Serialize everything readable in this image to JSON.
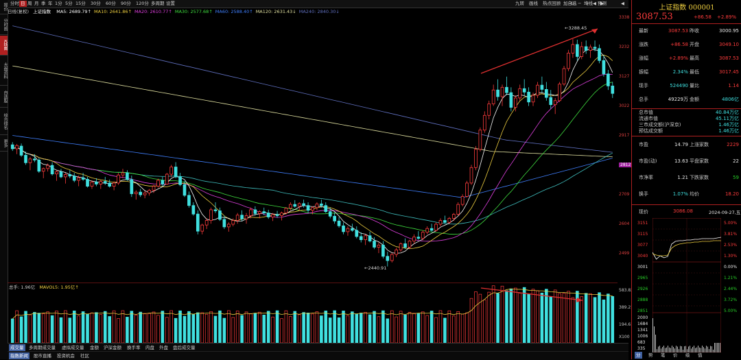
{
  "left_tabs": [
    "报价",
    "分时图",
    "K线图",
    "大盘资料",
    "自选股",
    "综合排名",
    "更多"
  ],
  "toolbar": {
    "left_items": [
      "分时",
      "日",
      "周",
      "月",
      "季",
      "年",
      "1分",
      "5分",
      "15分",
      "30分",
      "60分",
      "90分",
      "120分",
      "多周期",
      "设置"
    ],
    "right_items": [
      "九转",
      "画线",
      "热点回顾",
      "加自选",
      "均线",
      "预测"
    ],
    "icons": [
      "refresh-icon",
      "minus-icon",
      "plus-icon",
      "arrow-left-icon",
      "arrow-right-icon",
      "wrench-icon",
      "settings-icon",
      "play-icon"
    ]
  },
  "info_bar": {
    "series": "日线(复权)",
    "name": "上证指数",
    "ma": [
      {
        "label": "MA5: 2689.79↑",
        "color": "#ffffff"
      },
      {
        "label": "MA10: 2641.86↑",
        "color": "#f0d040"
      },
      {
        "label": "MA20: 2610.77↑",
        "color": "#e040e0"
      },
      {
        "label": "MA30: 2577.68↑",
        "color": "#40e040"
      },
      {
        "label": "MA60: 2588.40↑",
        "color": "#4080ff"
      },
      {
        "label": "MA120: 2631.43↓",
        "color": "#e0e0a0"
      },
      {
        "label": "MA240: 2840.30↓",
        "color": "#6070c0"
      }
    ]
  },
  "price_axis": {
    "ticks": [
      "3338",
      "3232",
      "3127",
      "3022",
      "2917",
      "2812",
      "2709",
      "2604",
      "2499"
    ],
    "highlight": "2812"
  },
  "annotations": {
    "high": "3288.45",
    "low": "2440.91"
  },
  "volume": {
    "label": "总手: 1.96亿",
    "mavol": "MAVOL5: 1.95亿↑",
    "ticks": [
      "583.82万",
      "389.21万",
      "194.61万",
      "X100"
    ]
  },
  "bottom_tabs_1": [
    "成交量",
    "多周期成交量",
    "虚拟成交量",
    "金额",
    "沪深金额",
    "换手率",
    "内盘",
    "外盘",
    "盘后成交量"
  ],
  "bottom_tabs_2": [
    "指数新闻",
    "股市直播",
    "投资机会",
    "社区"
  ],
  "quote": {
    "title": "上证指数 000001",
    "price": "3087.53",
    "change": "+86.58",
    "change_pct": "+2.89%"
  },
  "stats": [
    {
      "l1": "最新",
      "v1": "3087.53",
      "c1": "red",
      "l2": "昨收",
      "v2": "3000.95",
      "c2": "white"
    },
    {
      "l1": "涨跌",
      "v1": "+86.58",
      "c1": "red",
      "l2": "开盘",
      "v2": "3049.10",
      "c2": "red"
    },
    {
      "l1": "涨幅",
      "v1": "+2.89%",
      "c1": "red",
      "l2": "最高",
      "v2": "3087.53",
      "c2": "red"
    },
    {
      "l1": "振幅",
      "v1": "2.34%",
      "c1": "cyan",
      "l2": "最低",
      "v2": "3017.45",
      "c2": "red"
    },
    {
      "l1": "现手",
      "v1": "524490",
      "c1": "cyan",
      "l2": "量比",
      "v2": "1.14",
      "c2": "red"
    },
    {
      "l1": "总手",
      "v1": "49229万",
      "c1": "white",
      "l2": "金额",
      "v2": "4806亿",
      "c2": "cyan"
    }
  ],
  "market_values": [
    {
      "label": "总市值",
      "value": "40.84万亿"
    },
    {
      "label": "流通市值",
      "value": "45.11万亿"
    },
    {
      "label": "三市成交额(沪深京)",
      "value": "1.46万亿"
    },
    {
      "label": "预估成交额",
      "value": "1.46万亿"
    }
  ],
  "ratios": [
    {
      "l1": "市盈",
      "v1": "14.79",
      "l2": "上涨家数",
      "v2": "2229",
      "c2": "red"
    },
    {
      "l1": "市盈(动)",
      "v1": "13.63",
      "l2": "平盘家数",
      "v2": "22",
      "c2": "white"
    },
    {
      "l1": "市净率",
      "v1": "1.21",
      "l2": "下跌家数",
      "v2": "59",
      "c2": "green"
    },
    {
      "l1": "换手",
      "v1": "1.07%",
      "l2": "均价",
      "v2": "18.20",
      "c2": "red"
    }
  ],
  "mini": {
    "label": "现价",
    "price": "3086.08",
    "date": "2024-09-27,五",
    "left_ticks": [
      "3151",
      "3115",
      "3077",
      "3040",
      "3001",
      "2965",
      "2926",
      "2888",
      "2851"
    ],
    "right_ticks": [
      "5.00%",
      "3.81%",
      "2.53%",
      "1.30%",
      "0.00%",
      "1.21%",
      "2.44%",
      "3.72%",
      "5.00%"
    ],
    "vol_ticks": [
      "2000",
      "1684",
      "1341",
      "1006",
      "683",
      "335"
    ],
    "tabs": [
      "分",
      "势",
      "笔",
      "价",
      "级",
      "值"
    ]
  },
  "chart_data": {
    "type": "candlestick",
    "title": "上证指数",
    "ylim": [
      2380,
      3380
    ],
    "candles": [
      [
        2895,
        2905,
        2872,
        2880
      ],
      [
        2880,
        2898,
        2860,
        2892
      ],
      [
        2890,
        2900,
        2850,
        2856
      ],
      [
        2856,
        2870,
        2820,
        2828
      ],
      [
        2828,
        2850,
        2800,
        2842
      ],
      [
        2842,
        2860,
        2830,
        2838
      ],
      [
        2838,
        2845,
        2790,
        2796
      ],
      [
        2796,
        2810,
        2770,
        2806
      ],
      [
        2806,
        2825,
        2795,
        2818
      ],
      [
        2818,
        2830,
        2780,
        2786
      ],
      [
        2786,
        2800,
        2760,
        2794
      ],
      [
        2794,
        2805,
        2770,
        2775
      ],
      [
        2775,
        2790,
        2750,
        2784
      ],
      [
        2784,
        2800,
        2770,
        2778
      ],
      [
        2778,
        2790,
        2755,
        2762
      ],
      [
        2762,
        2780,
        2740,
        2772
      ],
      [
        2772,
        2790,
        2760,
        2766
      ],
      [
        2766,
        2775,
        2735,
        2740
      ],
      [
        2740,
        2762,
        2730,
        2756
      ],
      [
        2756,
        2770,
        2740,
        2748
      ],
      [
        2748,
        2762,
        2730,
        2758
      ],
      [
        2758,
        2775,
        2745,
        2752
      ],
      [
        2752,
        2765,
        2735,
        2740
      ],
      [
        2740,
        2758,
        2725,
        2752
      ],
      [
        2752,
        2790,
        2745,
        2782
      ],
      [
        2782,
        2805,
        2770,
        2790
      ],
      [
        2790,
        2800,
        2760,
        2765
      ],
      [
        2765,
        2780,
        2700,
        2712
      ],
      [
        2712,
        2725,
        2690,
        2718
      ],
      [
        2718,
        2730,
        2700,
        2708
      ],
      [
        2708,
        2722,
        2695,
        2715
      ],
      [
        2715,
        2730,
        2705,
        2725
      ],
      [
        2725,
        2745,
        2715,
        2740
      ],
      [
        2740,
        2768,
        2735,
        2762
      ],
      [
        2762,
        2775,
        2740,
        2748
      ],
      [
        2748,
        2790,
        2745,
        2785
      ],
      [
        2785,
        2820,
        2775,
        2812
      ],
      [
        2812,
        2830,
        2770,
        2775
      ],
      [
        2775,
        2790,
        2740,
        2746
      ],
      [
        2746,
        2760,
        2700,
        2706
      ],
      [
        2706,
        2720,
        2660,
        2668
      ],
      [
        2668,
        2680,
        2630,
        2636
      ],
      [
        2636,
        2650,
        2560,
        2572
      ],
      [
        2572,
        2600,
        2560,
        2595
      ],
      [
        2595,
        2620,
        2580,
        2612
      ],
      [
        2612,
        2660,
        2600,
        2652
      ],
      [
        2652,
        2680,
        2640,
        2648
      ],
      [
        2648,
        2660,
        2610,
        2616
      ],
      [
        2616,
        2630,
        2580,
        2588
      ],
      [
        2588,
        2605,
        2570,
        2598
      ],
      [
        2598,
        2620,
        2590,
        2612
      ],
      [
        2612,
        2640,
        2600,
        2632
      ],
      [
        2632,
        2650,
        2610,
        2618
      ],
      [
        2618,
        2640,
        2600,
        2630
      ],
      [
        2630,
        2660,
        2620,
        2652
      ],
      [
        2652,
        2665,
        2630,
        2638
      ],
      [
        2638,
        2650,
        2620,
        2645
      ],
      [
        2645,
        2660,
        2632,
        2640
      ],
      [
        2640,
        2652,
        2618,
        2625
      ],
      [
        2625,
        2640,
        2610,
        2634
      ],
      [
        2634,
        2648,
        2622,
        2630
      ],
      [
        2630,
        2645,
        2612,
        2640
      ],
      [
        2640,
        2662,
        2635,
        2658
      ],
      [
        2658,
        2680,
        2650,
        2672
      ],
      [
        2672,
        2688,
        2660,
        2665
      ],
      [
        2665,
        2680,
        2648,
        2675
      ],
      [
        2675,
        2690,
        2660,
        2668
      ],
      [
        2668,
        2680,
        2640,
        2650
      ],
      [
        2650,
        2665,
        2635,
        2660
      ],
      [
        2660,
        2680,
        2650,
        2674
      ],
      [
        2674,
        2690,
        2660,
        2668
      ],
      [
        2668,
        2680,
        2640,
        2645
      ],
      [
        2645,
        2660,
        2620,
        2628
      ],
      [
        2628,
        2642,
        2600,
        2610
      ],
      [
        2610,
        2625,
        2585,
        2592
      ],
      [
        2592,
        2605,
        2560,
        2570
      ],
      [
        2570,
        2590,
        2555,
        2582
      ],
      [
        2582,
        2600,
        2570,
        2575
      ],
      [
        2575,
        2590,
        2545,
        2552
      ],
      [
        2552,
        2568,
        2530,
        2540
      ],
      [
        2540,
        2560,
        2520,
        2555
      ],
      [
        2555,
        2570,
        2530,
        2535
      ],
      [
        2535,
        2550,
        2505,
        2512
      ],
      [
        2512,
        2530,
        2490,
        2520
      ],
      [
        2520,
        2535,
        2470,
        2478
      ],
      [
        2478,
        2495,
        2440,
        2462
      ],
      [
        2462,
        2490,
        2455,
        2485
      ],
      [
        2485,
        2510,
        2475,
        2502
      ],
      [
        2502,
        2530,
        2495,
        2525
      ],
      [
        2525,
        2545,
        2505,
        2512
      ],
      [
        2512,
        2540,
        2505,
        2535
      ],
      [
        2535,
        2560,
        2525,
        2550
      ],
      [
        2550,
        2572,
        2540,
        2545
      ],
      [
        2545,
        2575,
        2538,
        2568
      ],
      [
        2568,
        2590,
        2560,
        2582
      ],
      [
        2582,
        2600,
        2570,
        2575
      ],
      [
        2575,
        2605,
        2570,
        2598
      ],
      [
        2598,
        2620,
        2590,
        2612
      ],
      [
        2612,
        2630,
        2600,
        2605
      ],
      [
        2605,
        2625,
        2598,
        2620
      ],
      [
        2620,
        2640,
        2610,
        2635
      ],
      [
        2635,
        2680,
        2630,
        2672
      ],
      [
        2672,
        2710,
        2665,
        2702
      ],
      [
        2702,
        2760,
        2698,
        2752
      ],
      [
        2752,
        2820,
        2745,
        2810
      ],
      [
        2810,
        2890,
        2800,
        2878
      ],
      [
        2878,
        2960,
        2870,
        2950
      ],
      [
        2950,
        3020,
        2940,
        3005
      ],
      [
        3005,
        3060,
        2990,
        3048
      ],
      [
        3048,
        3120,
        3040,
        3100
      ],
      [
        3100,
        3140,
        3060,
        3075
      ],
      [
        3075,
        3120,
        3040,
        3110
      ],
      [
        3110,
        3150,
        3080,
        3090
      ],
      [
        3090,
        3110,
        3020,
        3035
      ],
      [
        3035,
        3080,
        3020,
        3070
      ],
      [
        3070,
        3120,
        3060,
        3105
      ],
      [
        3105,
        3140,
        3080,
        3092
      ],
      [
        3092,
        3110,
        3040,
        3055
      ],
      [
        3055,
        3090,
        3040,
        3080
      ],
      [
        3080,
        3130,
        3070,
        3118
      ],
      [
        3118,
        3150,
        3090,
        3102
      ],
      [
        3102,
        3130,
        3060,
        3072
      ],
      [
        3072,
        3100,
        3030,
        3045
      ],
      [
        3045,
        3070,
        3010,
        3060
      ],
      [
        3060,
        3130,
        3055,
        3122
      ],
      [
        3122,
        3190,
        3115,
        3180
      ],
      [
        3180,
        3250,
        3170,
        3238
      ],
      [
        3238,
        3290,
        3220,
        3270
      ],
      [
        3270,
        3288,
        3210,
        3225
      ],
      [
        3225,
        3280,
        3215,
        3262
      ],
      [
        3262,
        3285,
        3235,
        3248
      ],
      [
        3248,
        3270,
        3220,
        3260
      ],
      [
        3260,
        3285,
        3245,
        3255
      ],
      [
        3255,
        3270,
        3200,
        3210
      ],
      [
        3210,
        3230,
        3150,
        3160
      ],
      [
        3160,
        3175,
        3100,
        3115
      ],
      [
        3115,
        3130,
        3070,
        3087
      ]
    ]
  }
}
